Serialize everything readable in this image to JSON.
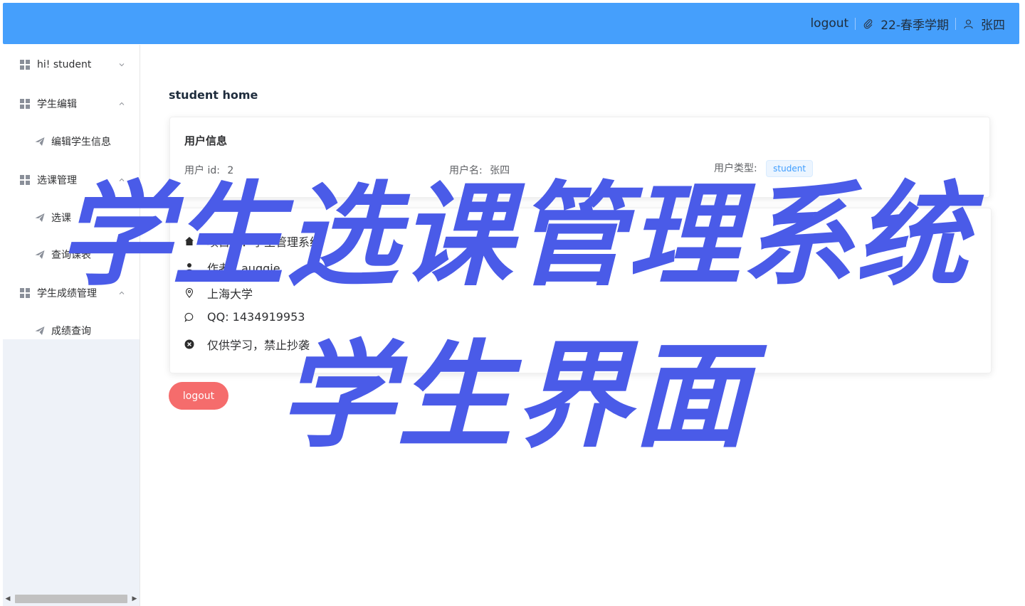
{
  "topbar": {
    "logout": "logout",
    "term": "22-春季学期",
    "username": "张四",
    "bg_color": "#459ffc"
  },
  "sidebar": {
    "groups": [
      {
        "label": "hi! student",
        "icon": "grid-icon",
        "expanded": false
      },
      {
        "label": "学生编辑",
        "icon": "grid-icon",
        "expanded": true,
        "items": [
          {
            "label": "编辑学生信息",
            "icon": "send-icon"
          }
        ]
      },
      {
        "label": "选课管理",
        "icon": "grid-icon",
        "expanded": true,
        "items": [
          {
            "label": "选课",
            "icon": "send-icon"
          },
          {
            "label": "查询课表",
            "icon": "send-icon"
          }
        ]
      },
      {
        "label": "学生成绩管理",
        "icon": "grid-icon",
        "expanded": true,
        "items": [
          {
            "label": "成绩查询",
            "icon": "send-icon"
          }
        ]
      }
    ]
  },
  "main": {
    "page_title": "student home",
    "user_card": {
      "title": "用户信息",
      "id_label": "用户 id:",
      "id_value": "2",
      "name_label": "用户名:",
      "name_value": "张四",
      "type_label": "用户类型:",
      "type_value": "student"
    },
    "project_card": {
      "project": "项目名：学生管理系统",
      "author": "作者：auggie",
      "location": "上海大学",
      "qq": "QQ: 1434919953",
      "notice": "仅供学习，禁止抄袭"
    },
    "logout_button": "logout",
    "logout_color": "#f56c6c"
  },
  "overlay": {
    "line1": "学生选课管理系统",
    "line2": "学生界面",
    "color": "#4a5be8"
  }
}
